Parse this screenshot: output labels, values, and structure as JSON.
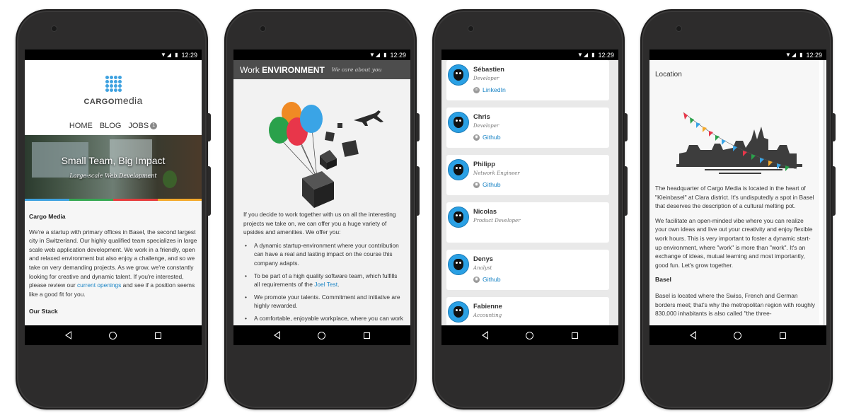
{
  "status": {
    "time": "12:29"
  },
  "phone1": {
    "brand_a": "CARGO",
    "brand_b": "media",
    "menu": [
      "HOME",
      "BLOG",
      "JOBS"
    ],
    "jobs_badge": "1",
    "hero_title": "Small Team, Big Impact",
    "hero_sub": "Large-scale Web Development",
    "section_title": "Cargo Media",
    "paragraph_pre": "We're a startup with primary offices in Basel, the second largest city in Switzerland. Our highly qualified team specializes in large scale web application development. We work in a friendly, open and relaxed environment but also enjoy a challenge, and so we take on very demanding projects. As we grow, we're constantly looking for creative and dynamic talent. If you're interested, please review our ",
    "paragraph_link": "current openings",
    "paragraph_post": " and see if a position seems like a good fit for you.",
    "stack_title": "Our Stack",
    "stripe_colors": [
      "#3fa2e0",
      "#36a852",
      "#e63c3c",
      "#f4a92b"
    ]
  },
  "phone2": {
    "header_a": "Work ",
    "header_b": "ENVIRONMENT",
    "header_care": "We care about you",
    "intro": "If you decide to work together with us on all the interesting projects we take on, we can offer you a huge variety of upsides and amenities. We offer you:",
    "bullets": [
      "A dynamic startup-environment where your contribution can have a real and lasting impact on the course this company adapts.",
      "To be part of a high quality software team, which fulfills all requirements of the ",
      "We promote your talents. Commitment and initiative are highly rewarded.",
      "A comfortable, enjoyable workplace, where you can work to your own accord. The hours are"
    ],
    "joel_link": "Joel Test",
    "joel_post": ".",
    "balloon_colors": [
      "#f08a24",
      "#e8364a",
      "#2aa14b",
      "#3aa4e6"
    ]
  },
  "phone3": {
    "people": [
      {
        "name": "Sébastien",
        "role": "Developer",
        "link": "LinkedIn",
        "link_icon": "in"
      },
      {
        "name": "Chris",
        "role": "Developer",
        "link": "Github",
        "link_icon": "gh"
      },
      {
        "name": "Philipp",
        "role": "Network Engineer",
        "link": "Github",
        "link_icon": "gh"
      },
      {
        "name": "Nicolas",
        "role": "Product Developer",
        "link": "",
        "link_icon": ""
      },
      {
        "name": "Denys",
        "role": "Analyst",
        "link": "Github",
        "link_icon": "gh"
      },
      {
        "name": "Fabienne",
        "role": "Accounting",
        "link": "",
        "link_icon": ""
      }
    ]
  },
  "phone4": {
    "title": "Location",
    "p1": "The headquarter of Cargo Media is located in the heart of \"Kleinbasel\" at Clara district. It's undisputedly a spot in Basel that deserves the description of a cultural melting pot.",
    "p2": "We facilitate an open-minded vibe where you can realize your own ideas and live out your creativity and enjoy flexible work hours. This is very important to foster a dynamic start-up environment, where \"work\" is more than \"work\". It's an exchange of ideas, mutual learning and most importantly, good fun. Let's grow together.",
    "basel_title": "Basel",
    "p3": "Basel is located where the Swiss, French and German borders meet; that's why the metropolitan region with roughly 830,000 inhabitants is also called \"the three-",
    "flag_colors": [
      "#e8364a",
      "#2aa14b",
      "#3aa4e6",
      "#f4a92b"
    ]
  }
}
